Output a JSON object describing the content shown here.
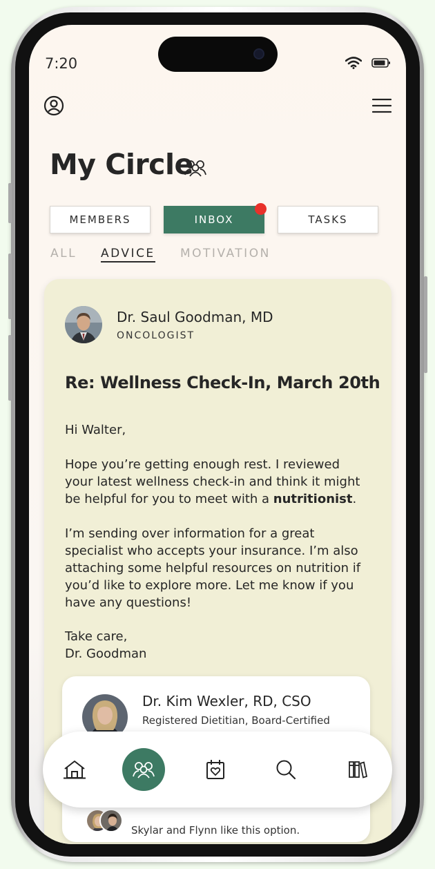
{
  "status_bar": {
    "time": "7:20"
  },
  "header": {
    "title": "My Circle"
  },
  "tabs": [
    {
      "label": "MEMBERS",
      "active": false
    },
    {
      "label": "INBOX",
      "active": true,
      "has_notification": true
    },
    {
      "label": "TASKS",
      "active": false
    }
  ],
  "subtabs": [
    {
      "label": "ALL",
      "active": false
    },
    {
      "label": "ADVICE",
      "active": true
    },
    {
      "label": "MOTIVATION",
      "active": false
    }
  ],
  "message": {
    "sender_name": "Dr. Saul Goodman, MD",
    "sender_role": "ONCOLOGIST",
    "subject": "Re: Wellness Check-In, March 20th",
    "greeting": "Hi Walter,",
    "paragraph1_pre": "Hope you’re getting enough rest. I reviewed your latest wellness check-in and think it might be helpful for you to meet with a ",
    "paragraph1_bold": "nutritionist",
    "paragraph1_post": ".",
    "paragraph2": "I’m sending over information for a great specialist who accepts your insurance. I’m also attaching some helpful resources on nutrition if you’d like to explore more. Let me know if you have any questions!",
    "signoff": "Take care,",
    "signature": "Dr. Goodman"
  },
  "specialist": {
    "name": "Dr. Kim Wexler, RD, CSO",
    "role": "Registered Dietitian, Board-Certified",
    "likes_text": "Skylar and Flynn like this option."
  },
  "bottom_nav": [
    {
      "icon": "home-icon",
      "active": false
    },
    {
      "icon": "people-icon",
      "active": true
    },
    {
      "icon": "calendar-heart-icon",
      "active": false
    },
    {
      "icon": "search-icon",
      "active": false
    },
    {
      "icon": "library-icon",
      "active": false
    }
  ],
  "colors": {
    "accent": "#3d7a63",
    "notification": "#e8312a",
    "card_bg": "#f1efd6",
    "page_bg": "#f2fbee"
  }
}
